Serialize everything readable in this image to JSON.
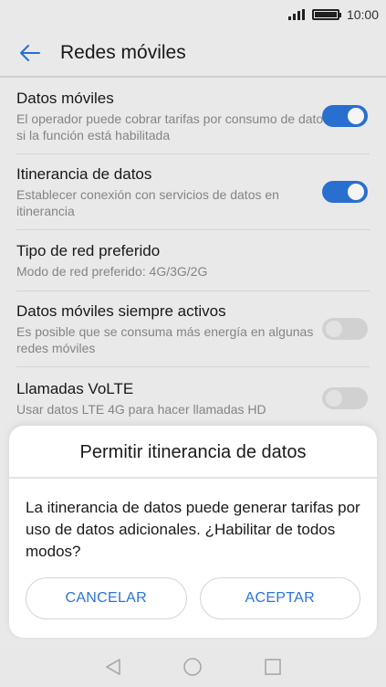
{
  "status_bar": {
    "time": "10:00"
  },
  "app_bar": {
    "title": "Redes móviles"
  },
  "settings": [
    {
      "title": "Datos móviles",
      "subtitle": "El operador puede cobrar tarifas por consumo de datos si la función está habilitada",
      "toggle": "on"
    },
    {
      "title": "Itinerancia de datos",
      "subtitle": "Establecer conexión con servicios de datos en itinerancia",
      "toggle": "on"
    },
    {
      "title": "Tipo de red preferido",
      "subtitle": "Modo de red preferido: 4G/3G/2G",
      "toggle": null
    },
    {
      "title": "Datos móviles siempre activos",
      "subtitle": "Es posible que se consuma más energía en algunas redes móviles",
      "toggle": "off"
    },
    {
      "title": "Llamadas VoLTE",
      "subtitle": "Usar datos LTE 4G para hacer llamadas HD",
      "toggle": "off"
    }
  ],
  "dialog": {
    "title": "Permitir itinerancia de datos",
    "message": "La itinerancia de datos puede generar tarifas por uso de datos adicionales. ¿Habilitar de todos modos?",
    "cancel_label": "CANCELAR",
    "accept_label": "ACEPTAR"
  },
  "colors": {
    "accent": "#2a74d9",
    "toggle_off": "#dadada"
  }
}
